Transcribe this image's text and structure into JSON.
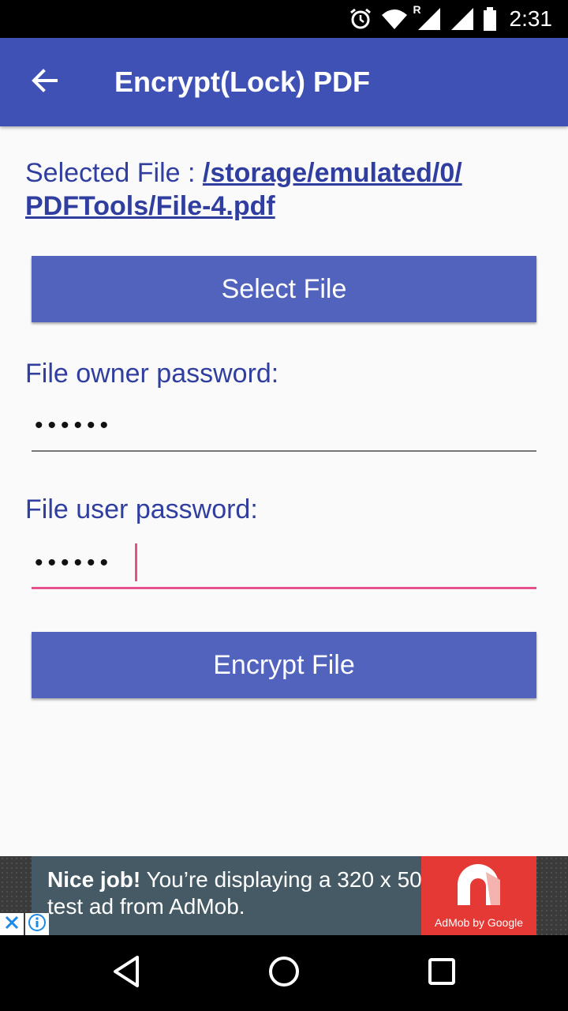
{
  "status_bar": {
    "time": "2:31",
    "roaming_label": "R"
  },
  "app_bar": {
    "title": "Encrypt(Lock) PDF",
    "back_icon": "arrow-back-icon"
  },
  "selected_file": {
    "label": "Selected File : ",
    "path_line1": "/storage/emulated/0/",
    "path_line2": "PDFTools/File-4.pdf"
  },
  "buttons": {
    "select_file": "Select File",
    "encrypt_file": "Encrypt File"
  },
  "owner_password": {
    "label": "File owner password:",
    "masked_value": "••••••"
  },
  "user_password": {
    "label": "File user password:",
    "masked_value": "••••••"
  },
  "ad": {
    "headline": "Nice job!",
    "line1_rest": " You’re displaying a 320 x 50",
    "line2": "test ad from AdMob.",
    "logo_caption": "AdMob by Google"
  },
  "colors": {
    "primary": "#3f51b5",
    "button": "#5163bd",
    "accent": "#e5528b",
    "text_primary": "#303f9f"
  }
}
